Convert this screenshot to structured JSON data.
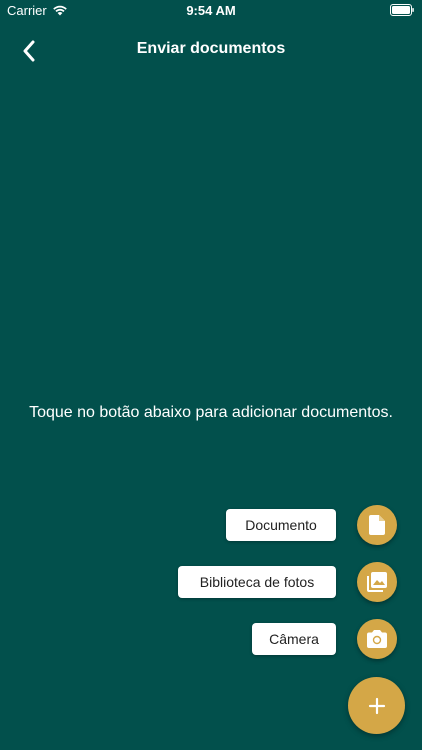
{
  "status_bar": {
    "carrier": "Carrier",
    "time": "9:54 AM"
  },
  "nav": {
    "title": "Enviar documentos",
    "back_icon": "chevron-left-icon"
  },
  "empty_state": {
    "message": "Toque no botão abaixo para adicionar documentos."
  },
  "fab_menu": {
    "items": [
      {
        "label": "Documento",
        "icon": "document-icon"
      },
      {
        "label": "Biblioteca de fotos",
        "icon": "photo-library-icon"
      },
      {
        "label": "Câmera",
        "icon": "camera-icon"
      }
    ],
    "main_icon": "plus-icon"
  },
  "colors": {
    "background": "#02504c",
    "accent": "#d4a747",
    "label_bg": "#ffffff"
  }
}
